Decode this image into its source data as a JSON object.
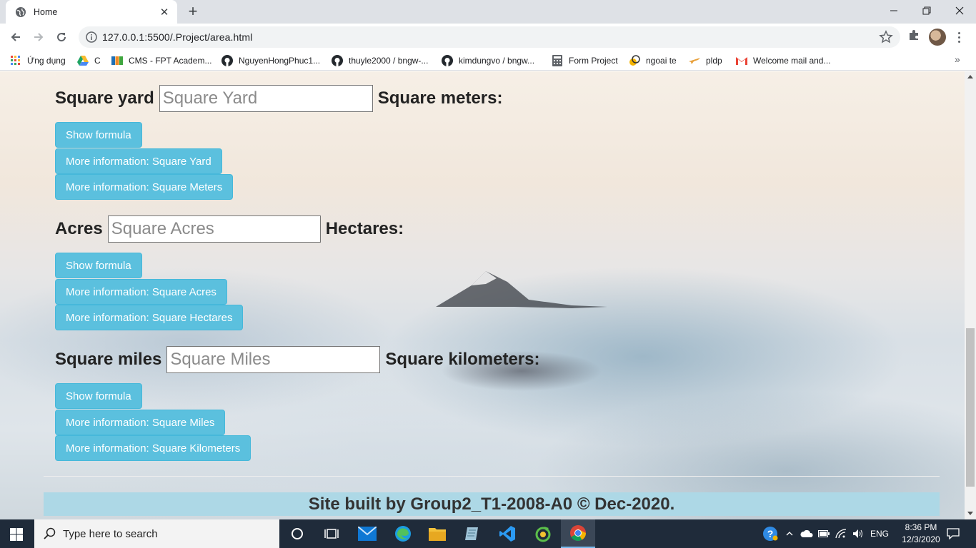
{
  "browser": {
    "tab_title": "Home",
    "url": "127.0.0.1:5500/.Project/area.html",
    "bookmarks": [
      {
        "label": "Ứng dụng",
        "icon": "apps-grid-icon"
      },
      {
        "label": "C",
        "icon": "google-drive-icon"
      },
      {
        "label": "CMS - FPT Academ...",
        "icon": "fpt-icon"
      },
      {
        "label": "NguyenHongPhuc1...",
        "icon": "github-icon"
      },
      {
        "label": "thuyle2000 / bngw-...",
        "icon": "github-icon"
      },
      {
        "label": "kimdungvo / bngw...",
        "icon": "github-icon"
      },
      {
        "label": "Form Project",
        "icon": "calculator-icon"
      },
      {
        "label": "ngoai te",
        "icon": "currency-icon"
      },
      {
        "label": "pldp",
        "icon": "plane-icon"
      },
      {
        "label": "Welcome mail and...",
        "icon": "gmail-icon"
      }
    ],
    "bookmarks_overflow": "»"
  },
  "page": {
    "sections": [
      {
        "label": "Square yard",
        "placeholder": "Square Yard",
        "result_label": "Square meters:",
        "buttons": [
          "Show formula",
          "More information: Square Yard",
          "More information: Square Meters"
        ]
      },
      {
        "label": "Acres",
        "placeholder": "Square Acres",
        "result_label": "Hectares:",
        "buttons": [
          "Show formula",
          "More information: Square Acres",
          "More information: Square Hectares"
        ]
      },
      {
        "label": "Square miles",
        "placeholder": "Square Miles",
        "result_label": "Square kilometers:",
        "buttons": [
          "Show formula",
          "More information: Square Miles",
          "More information: Square Kilometers"
        ]
      }
    ],
    "footer": "Site built by Group2_T1-2008-A0 © Dec-2020."
  },
  "taskbar": {
    "search_placeholder": "Type here to search",
    "language": "ENG",
    "time": "8:36 PM",
    "date": "12/3/2020"
  },
  "colors": {
    "button_bg": "#5bc0de",
    "footer_bg": "#add8e6",
    "taskbar_bg": "#1f2b3a"
  }
}
